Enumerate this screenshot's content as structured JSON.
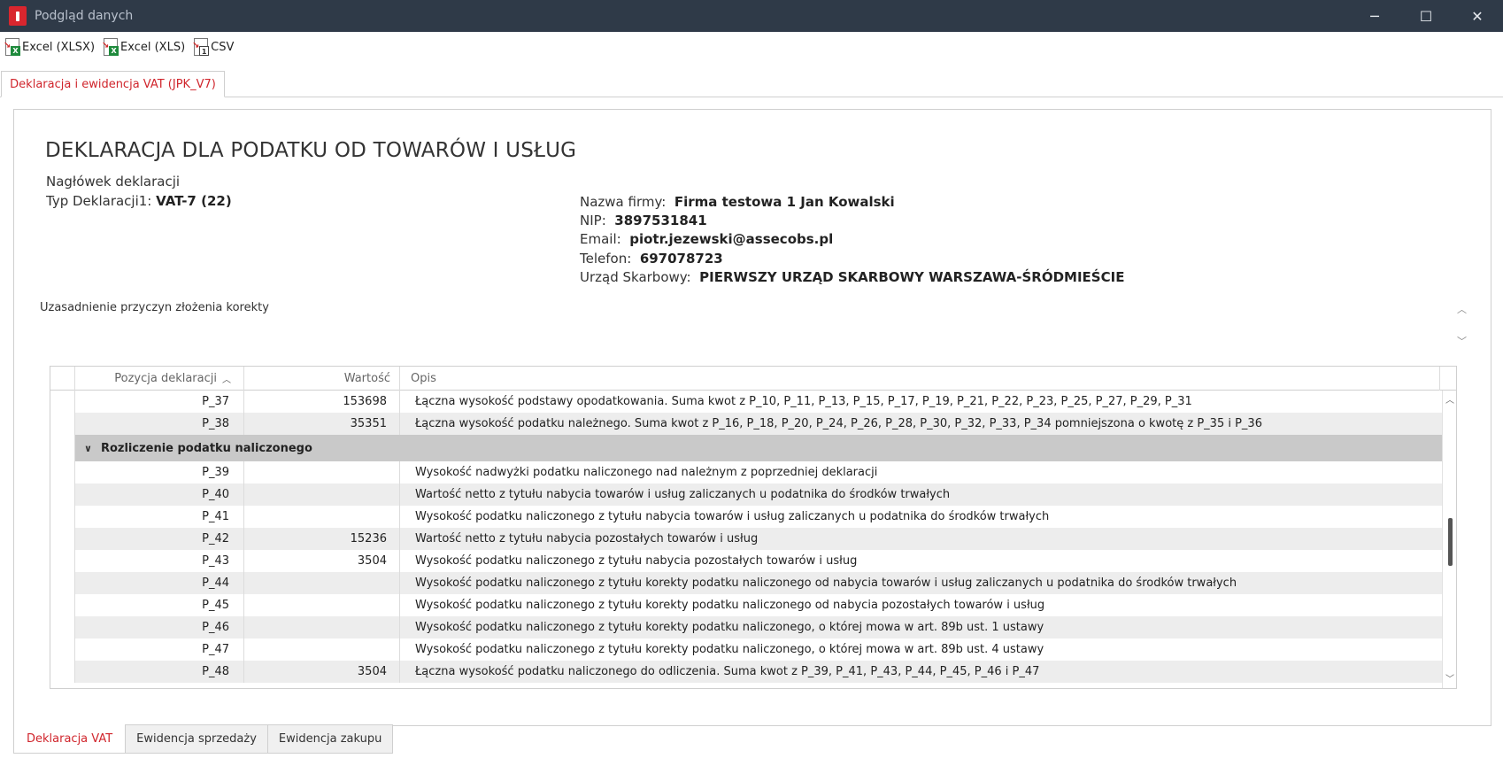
{
  "window": {
    "title": "Podgląd danych",
    "controls": {
      "minimize": "─",
      "maximize": "☐",
      "close": "✕"
    }
  },
  "toolbar": {
    "buttons": [
      {
        "label": "Excel (XLSX)",
        "icon": "excel-xlsx-icon",
        "badge": "X"
      },
      {
        "label": "Excel (XLS)",
        "icon": "excel-xls-icon",
        "badge": "X"
      },
      {
        "label": "CSV",
        "icon": "csv-icon",
        "badge": "1"
      }
    ]
  },
  "top_tab": {
    "label": "Deklaracja i ewidencja VAT (JPK_V7)"
  },
  "declaration": {
    "title": "DEKLARACJA DLA PODATKU OD TOWARÓW I USŁUG",
    "header_label": "Nagłówek deklaracji",
    "typ_label": "Typ Deklaracji1:",
    "typ_value": "VAT-7 (22)",
    "firm": {
      "name_label": "Nazwa firmy:",
      "name_value": "Firma testowa 1 Jan Kowalski",
      "nip_label": "NIP:",
      "nip_value": "3897531841",
      "email_label": "Email:",
      "email_value": "piotr.jezewski@assecobs.pl",
      "phone_label": "Telefon:",
      "phone_value": "697078723",
      "office_label": "Urząd Skarbowy:",
      "office_value": "PIERWSZY URZĄD SKARBOWY WARSZAWA-ŚRÓDMIEŚCIE"
    },
    "justification_label": "Uzasadnienie przyczyn złożenia korekty"
  },
  "grid": {
    "columns": {
      "position": "Pozycja deklaracji",
      "value": "Wartość",
      "description": "Opis"
    },
    "rows_top": [
      {
        "pos": "P_37",
        "val": "153698",
        "desc": "Łączna wysokość podstawy opodatkowania. Suma kwot z P_10, P_11, P_13, P_15, P_17, P_19, P_21, P_22, P_23, P_25, P_27, P_29, P_31"
      },
      {
        "pos": "P_38",
        "val": "35351",
        "desc": "Łączna wysokość podatku należnego. Suma kwot z P_16, P_18, P_20, P_24, P_26, P_28, P_30, P_32, P_33, P_34 pomniejszona o kwotę z P_35 i P_36"
      }
    ],
    "group_label": "Rozliczenie podatku naliczonego",
    "rows_group": [
      {
        "pos": "P_39",
        "val": "",
        "desc": "Wysokość nadwyżki podatku naliczonego nad należnym z poprzedniej deklaracji"
      },
      {
        "pos": "P_40",
        "val": "",
        "desc": "Wartość netto z tytułu nabycia towarów i usług zaliczanych u podatnika do środków trwałych"
      },
      {
        "pos": "P_41",
        "val": "",
        "desc": "Wysokość podatku naliczonego z tytułu nabycia towarów i usług zaliczanych u podatnika do środków trwałych"
      },
      {
        "pos": "P_42",
        "val": "15236",
        "desc": "Wartość netto z tytułu nabycia pozostałych towarów i usług"
      },
      {
        "pos": "P_43",
        "val": "3504",
        "desc": "Wysokość podatku naliczonego z tytułu nabycia pozostałych towarów i usług"
      },
      {
        "pos": "P_44",
        "val": "",
        "desc": "Wysokość podatku naliczonego z tytułu korekty podatku naliczonego od nabycia towarów i usług zaliczanych u podatnika do środków trwałych"
      },
      {
        "pos": "P_45",
        "val": "",
        "desc": "Wysokość podatku naliczonego z tytułu korekty podatku naliczonego od nabycia pozostałych towarów i usług"
      },
      {
        "pos": "P_46",
        "val": "",
        "desc": "Wysokość podatku naliczonego z tytułu korekty podatku naliczonego, o której mowa w art. 89b ust. 1 ustawy"
      },
      {
        "pos": "P_47",
        "val": "",
        "desc": "Wysokość podatku naliczonego z tytułu korekty podatku naliczonego, o której mowa w art. 89b ust. 4 ustawy"
      },
      {
        "pos": "P_48",
        "val": "3504",
        "desc": "Łączna wysokość podatku naliczonego do odliczenia. Suma kwot z P_39, P_41, P_43, P_44, P_45, P_46 i P_47"
      }
    ]
  },
  "bottom_tabs": [
    {
      "label": "Deklaracja VAT",
      "active": true
    },
    {
      "label": "Ewidencja sprzedaży",
      "active": false
    },
    {
      "label": "Ewidencja zakupu",
      "active": false
    }
  ],
  "colors": {
    "accent": "#d0252c",
    "titlebar": "#2f3a48",
    "group_row": "#c9c9c9",
    "alt_row": "#ededed"
  }
}
